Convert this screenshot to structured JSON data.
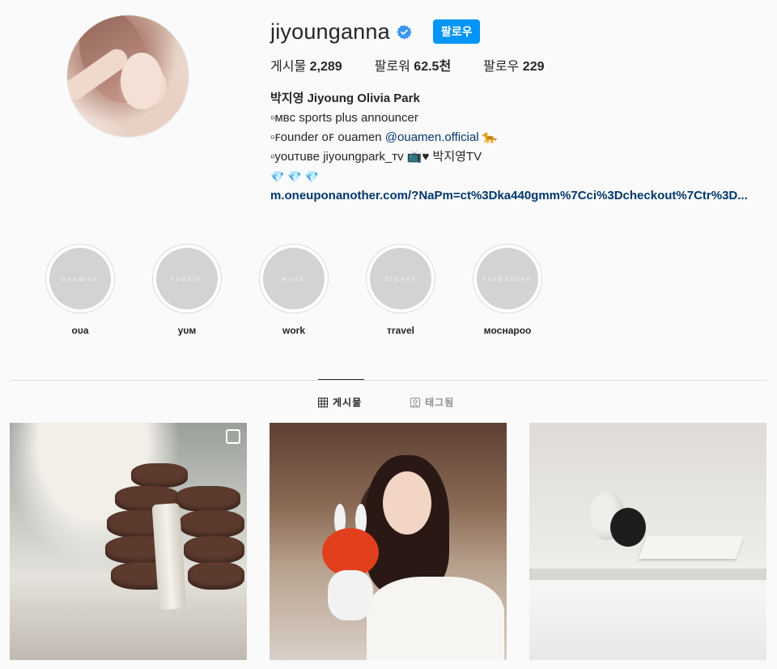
{
  "profile": {
    "username": "jiyounganna",
    "follow_label": "팔로우",
    "stats": [
      {
        "label": "게시물",
        "value": "2,289"
      },
      {
        "label": "팔로워",
        "value": "62.5천"
      },
      {
        "label": "팔로우",
        "value": "229"
      }
    ],
    "full_name": "박지영 Jiyoung Olivia Park",
    "bio_lines": [
      "▫ᴍʙᴄ sports plus announcer",
      "▫ꜰounder oꜰ ouamen ",
      "▫youᴛuʙe jiyoungpark_ᴛv 📺♥ 박지영TV"
    ],
    "mention": "@ouamen.official",
    "mention_emoji": "🐆",
    "gems": "💎 💎 💎",
    "link": "m.oneuponanother.com/?NaPm=ct%3Dka440gmm%7Cci%3Dcheckout%7Ctr%3D..."
  },
  "highlights": [
    {
      "cover_text": "ouamen",
      "label": "oᴜa"
    },
    {
      "cover_text": "foodie",
      "label": "yᴜᴍ"
    },
    {
      "cover_text": "work",
      "label": "work"
    },
    {
      "cover_text": "travel",
      "label": "ᴛravel"
    },
    {
      "cover_text": "furbabies",
      "label": "ᴍocнapoo"
    }
  ],
  "tabs": [
    {
      "label": "게시물",
      "icon": "grid-icon",
      "active": true
    },
    {
      "label": "태그됨",
      "icon": "tagged-icon",
      "active": false
    }
  ],
  "posts": [
    {
      "alt": "towels-and-bottle"
    },
    {
      "alt": "girl-with-plush"
    },
    {
      "alt": "vases-and-book"
    }
  ],
  "colors": {
    "accent": "#0095f6",
    "verified": "#3897f0",
    "link": "#00376b"
  }
}
